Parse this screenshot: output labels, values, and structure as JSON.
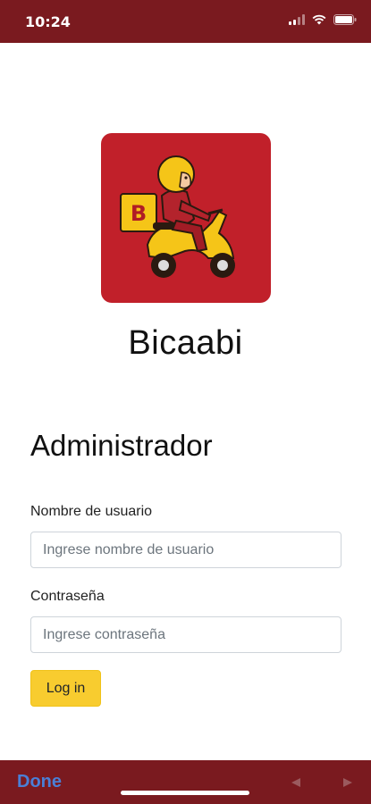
{
  "status_bar": {
    "time": "10:24"
  },
  "app": {
    "name": "Bicaabi"
  },
  "form": {
    "title": "Administrador",
    "username_label": "Nombre de usuario",
    "username_placeholder": "Ingrese nombre de usuario",
    "username_value": "",
    "password_label": "Contraseña",
    "password_placeholder": "Ingrese contraseña",
    "password_value": "",
    "login_label": "Log in"
  },
  "browser_bar": {
    "done_label": "Done"
  },
  "icons": {
    "status": [
      "signal-icon",
      "wifi-icon",
      "battery-icon"
    ],
    "nav": [
      "back-arrow-icon",
      "forward-arrow-icon"
    ]
  },
  "colors": {
    "brand_bar": "#7a1a1f",
    "logo_background": "#c1202a",
    "button": "#f8cc2f",
    "done_link": "#4a7fd6"
  }
}
